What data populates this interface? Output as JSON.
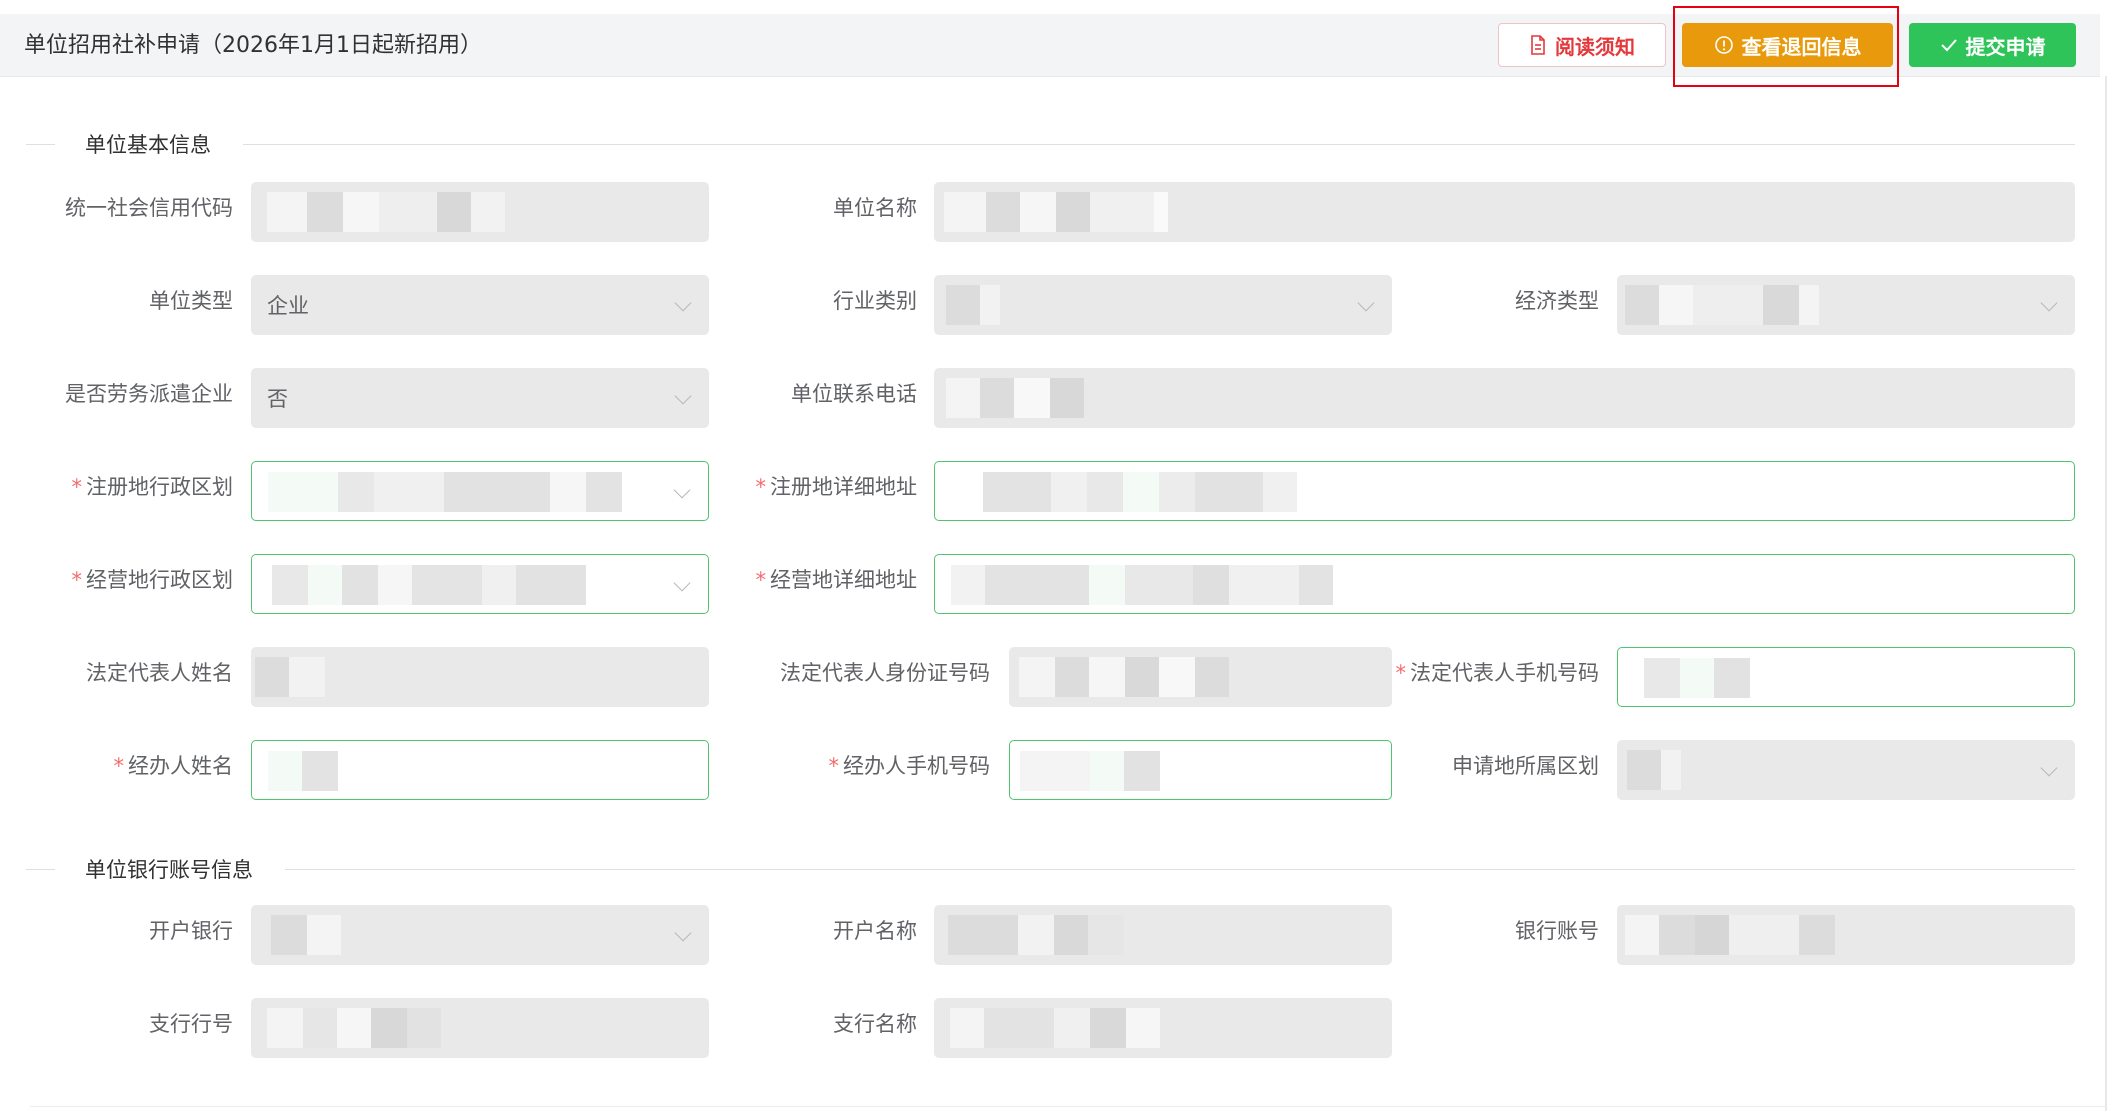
{
  "header": {
    "title": "单位招用社补申请（2026年1月1日起新招用）",
    "buttons": {
      "read": "阅读须知",
      "return_info": "查看退回信息",
      "submit": "提交申请"
    }
  },
  "sections": {
    "basic": "单位基本信息",
    "bank": "单位银行账号信息"
  },
  "labels": {
    "credit_code": "统一社会信用代码",
    "unit_name": "单位名称",
    "unit_type": "单位类型",
    "industry": "行业类别",
    "economic_type": "经济类型",
    "labor_dispatch": "是否劳务派遣企业",
    "unit_phone": "单位联系电话",
    "reg_region": "注册地行政区划",
    "reg_address": "注册地详细地址",
    "biz_region": "经营地行政区划",
    "biz_address": "经营地详细地址",
    "legal_name": "法定代表人姓名",
    "legal_id": "法定代表人身份证号码",
    "legal_phone": "法定代表人手机号码",
    "agent_name": "经办人姓名",
    "agent_phone": "经办人手机号码",
    "apply_region": "申请地所属区划",
    "bank": "开户银行",
    "account_name": "开户名称",
    "account_no": "银行账号",
    "branch_no": "支行行号",
    "branch_name": "支行名称"
  },
  "required_mark": "*",
  "values": {
    "unit_type": "企业",
    "labor_dispatch": "否"
  }
}
